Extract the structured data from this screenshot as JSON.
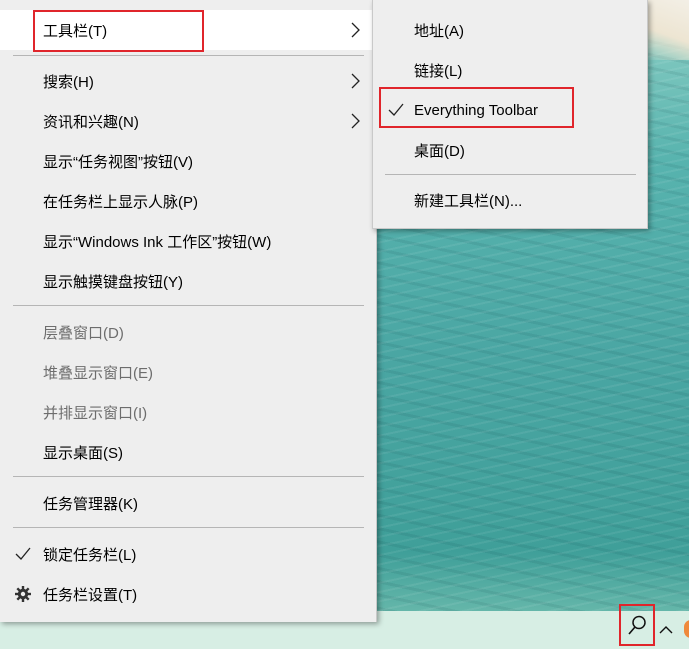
{
  "taskbar_menu": {
    "items": [
      {
        "label": "工具栏(T)"
      },
      {
        "label": "搜索(H)"
      },
      {
        "label": "资讯和兴趣(N)"
      },
      {
        "label": "显示“任务视图”按钮(V)"
      },
      {
        "label": "在任务栏上显示人脉(P)"
      },
      {
        "label": "显示“Windows Ink 工作区”按钮(W)"
      },
      {
        "label": "显示触摸键盘按钮(Y)"
      },
      {
        "label": "层叠窗口(D)"
      },
      {
        "label": "堆叠显示窗口(E)"
      },
      {
        "label": "并排显示窗口(I)"
      },
      {
        "label": "显示桌面(S)"
      },
      {
        "label": "任务管理器(K)"
      },
      {
        "label": "锁定任务栏(L)"
      },
      {
        "label": "任务栏设置(T)"
      }
    ]
  },
  "toolbars_submenu": {
    "items": [
      {
        "label": "地址(A)"
      },
      {
        "label": "链接(L)"
      },
      {
        "label": "Everything Toolbar"
      },
      {
        "label": "桌面(D)"
      },
      {
        "label": "新建工具栏(N)..."
      }
    ]
  },
  "icons": {
    "submenu_arrow": "chevron-right-icon",
    "checked": "checkmark-icon",
    "settings": "gear-icon",
    "search": "search-icon",
    "tray": "chevron-up-icon"
  },
  "colors": {
    "menu_bg": "#eeeeee",
    "highlight_box": "#e0252b",
    "taskbar_bg": "#d7eee4"
  }
}
